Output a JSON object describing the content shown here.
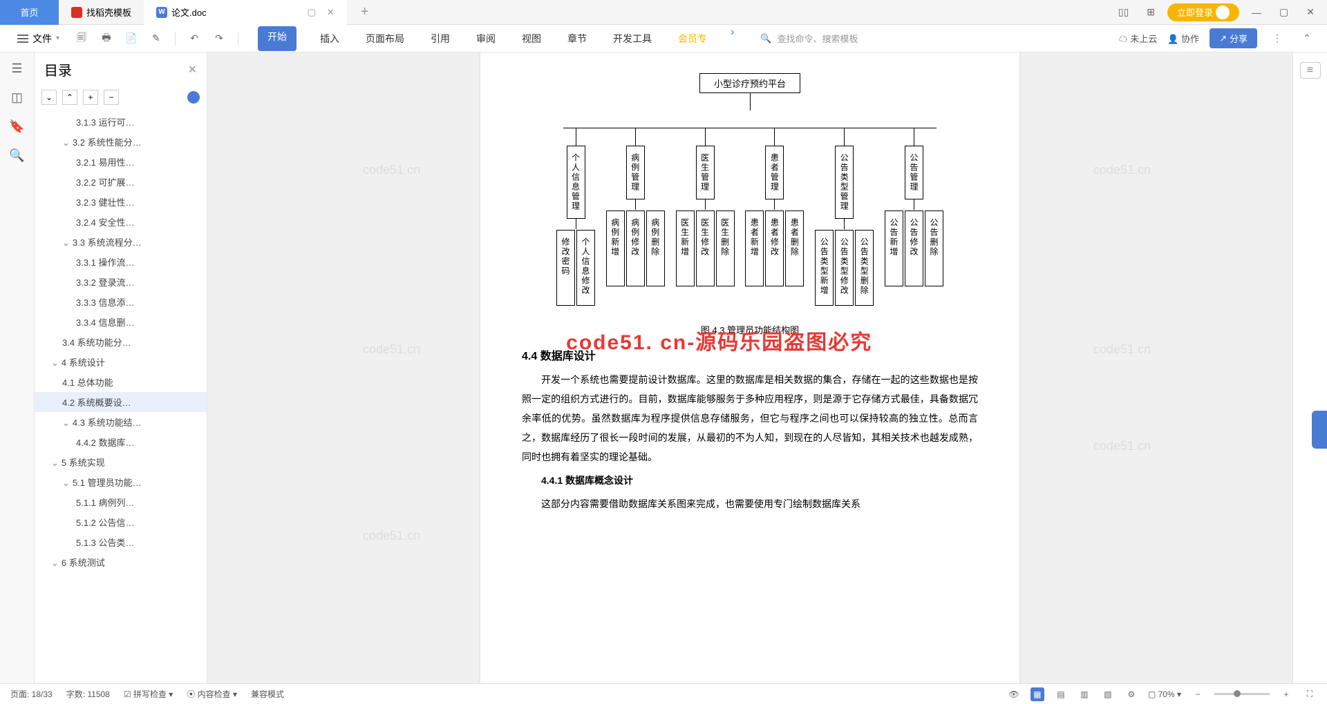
{
  "titlebar": {
    "home": "首页",
    "tab_template": "找稻壳模板",
    "tab_doc": "论文.doc"
  },
  "window": {
    "login": "立即登录"
  },
  "toolbar": {
    "file": "文件",
    "tabs": [
      "开始",
      "插入",
      "页面布局",
      "引用",
      "审阅",
      "视图",
      "章节",
      "开发工具",
      "会员专"
    ],
    "search_placeholder": "查找命令、搜索模板",
    "cloud": "未上云",
    "collab": "协作",
    "share": "分享"
  },
  "outline": {
    "title": "目录",
    "items": [
      {
        "lvl": 3,
        "label": "3.1.3 运行可…"
      },
      {
        "lvl": 2,
        "label": "3.2 系统性能分…",
        "exp": true
      },
      {
        "lvl": 3,
        "label": "3.2.1 易用性…"
      },
      {
        "lvl": 3,
        "label": "3.2.2 可扩展…"
      },
      {
        "lvl": 3,
        "label": "3.2.3 健壮性…"
      },
      {
        "lvl": 3,
        "label": "3.2.4 安全性…"
      },
      {
        "lvl": 2,
        "label": "3.3 系统流程分…",
        "exp": true
      },
      {
        "lvl": 3,
        "label": "3.3.1 操作流…"
      },
      {
        "lvl": 3,
        "label": "3.3.2 登录流…"
      },
      {
        "lvl": 3,
        "label": "3.3.3 信息添…"
      },
      {
        "lvl": 3,
        "label": "3.3.4 信息删…"
      },
      {
        "lvl": 2,
        "label": "3.4 系统功能分…"
      },
      {
        "lvl": 1,
        "label": "4 系统设计",
        "exp": true
      },
      {
        "lvl": 2,
        "label": "4.1 总体功能"
      },
      {
        "lvl": 2,
        "label": "4.2 系统概要设…",
        "active": true
      },
      {
        "lvl": 2,
        "label": "4.3 系统功能结…",
        "exp": true
      },
      {
        "lvl": 3,
        "label": "4.4.2 数据库…"
      },
      {
        "lvl": 1,
        "label": "5 系统实现",
        "exp": true
      },
      {
        "lvl": 2,
        "label": "5.1 管理员功能…",
        "exp": true
      },
      {
        "lvl": 3,
        "label": "5.1.1 病例列…"
      },
      {
        "lvl": 3,
        "label": "5.1.2 公告信…"
      },
      {
        "lvl": 3,
        "label": "5.1.3 公告类…"
      },
      {
        "lvl": 1,
        "label": "6 系统测试",
        "exp": true
      }
    ]
  },
  "chart_data": {
    "type": "tree",
    "root": "小型诊疗预约平台",
    "children": [
      {
        "name": "个人信息管理",
        "children": [
          "修改密码",
          "个人信息修改"
        ]
      },
      {
        "name": "病例管理",
        "children": [
          "病例新增",
          "病例修改",
          "病例删除"
        ]
      },
      {
        "name": "医生管理",
        "children": [
          "医生新增",
          "医生修改",
          "医生删除"
        ]
      },
      {
        "name": "患者管理",
        "children": [
          "患者新增",
          "患者修改",
          "患者删除"
        ]
      },
      {
        "name": "公告类型管理",
        "children": [
          "公告类型新增",
          "公告类型修改",
          "公告类型删除"
        ]
      },
      {
        "name": "公告管理",
        "children": [
          "公告新增",
          "公告修改",
          "公告删除"
        ]
      }
    ]
  },
  "doc": {
    "caption": "图 4.3 管理员功能结构图",
    "h44": "4.4 数据库设计",
    "p1": "开发一个系统也需要提前设计数据库。这里的数据库是相关数据的集合，存储在一起的这些数据也是按照一定的组织方式进行的。目前，数据库能够服务于多种应用程序，则是源于它存储方式最佳，具备数据冗余率低的优势。虽然数据库为程序提供信息存储服务，但它与程序之间也可以保持较高的独立性。总而言之，数据库经历了很长一段时间的发展，从最初的不为人知，到现在的人尽皆知，其相关技术也越发成熟，同时也拥有着坚实的理论基础。",
    "h441": "4.4.1 数据库概念设计",
    "p2": "这部分内容需要借助数据库关系图来完成，也需要使用专门绘制数据库关系"
  },
  "overlay": "code51. cn-源码乐园盗图必究",
  "watermark": "code51.cn",
  "statusbar": {
    "page": "页面: 18/33",
    "words": "字数: 11508",
    "spell": "拼写检查",
    "content": "内容检查",
    "compat": "兼容模式",
    "zoom": "70%"
  }
}
